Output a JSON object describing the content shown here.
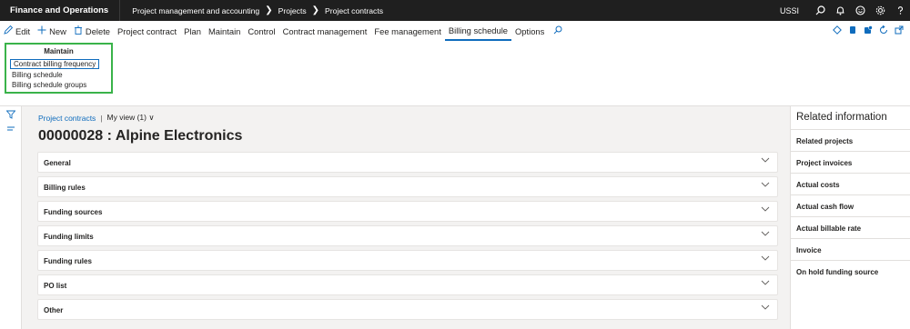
{
  "topbar": {
    "app_title": "Finance and Operations",
    "crumbs": [
      "Project management and accounting",
      "Projects",
      "Project contracts"
    ],
    "crumb_separator": "❯",
    "company": "USSI",
    "icons": [
      "search-icon",
      "bell-icon",
      "smiley-icon",
      "gear-icon",
      "help-icon"
    ]
  },
  "actionpane": {
    "edit": "Edit",
    "new": "New",
    "delete": "Delete",
    "tabs": [
      "Project contract",
      "Plan",
      "Maintain",
      "Control",
      "Contract management",
      "Fee management",
      "Billing schedule",
      "Options"
    ],
    "active_tab": "Billing schedule"
  },
  "ribbon": {
    "group_title": "Maintain",
    "items": [
      "Contract billing frequency",
      "Billing schedule",
      "Billing schedule groups"
    ],
    "selected_item": "Contract billing frequency"
  },
  "main": {
    "breadcrumb_link": "Project contracts",
    "pipe": "|",
    "view": "My view (1)",
    "view_chevron": "∨",
    "title": "00000028 : Alpine Electronics",
    "fasttabs": [
      "General",
      "Billing rules",
      "Funding sources",
      "Funding limits",
      "Funding rules",
      "PO list",
      "Other"
    ]
  },
  "related": {
    "title": "Related information",
    "items": [
      "Related projects",
      "Project invoices",
      "Actual costs",
      "Actual cash flow",
      "Actual billable rate",
      "Invoice",
      "On hold funding source"
    ]
  },
  "colors": {
    "accent": "#0f6cbd",
    "topbar": "#1f1f1f",
    "highlight_box": "#3ab34a",
    "content_bg": "#f3f2f1"
  }
}
